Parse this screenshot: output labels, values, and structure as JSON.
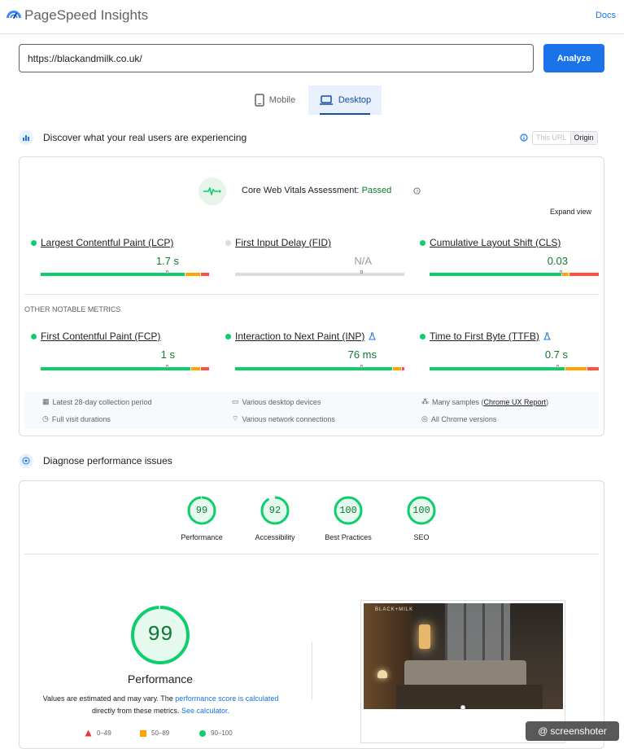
{
  "header": {
    "title": "PageSpeed Insights",
    "docs_label": "Docs"
  },
  "search": {
    "url": "https://blackandmilk.co.uk/",
    "analyze_label": "Analyze"
  },
  "tabs": [
    {
      "label": "Mobile"
    },
    {
      "label": "Desktop",
      "selected": true
    }
  ],
  "real_users": {
    "heading": "Discover what your real users are experiencing",
    "toggle": {
      "this_url": "This URL",
      "origin": "Origin"
    },
    "assessment_label": "Core Web Vitals Assessment:",
    "assessment_status": "Passed",
    "expand_label": "Expand view",
    "metrics": [
      {
        "name": "Largest Contentful Paint (LCP)",
        "value": "1.7 s",
        "status": "good"
      },
      {
        "name": "First Input Delay (FID)",
        "value": "N/A",
        "status": "none"
      },
      {
        "name": "Cumulative Layout Shift (CLS)",
        "value": "0.03",
        "status": "good"
      }
    ],
    "other_label": "OTHER NOTABLE METRICS",
    "other_metrics": [
      {
        "name": "First Contentful Paint (FCP)",
        "value": "1 s"
      },
      {
        "name": "Interaction to Next Paint (INP)",
        "value": "76 ms"
      },
      {
        "name": "Time to First Byte (TTFB)",
        "value": "0.7 s"
      }
    ],
    "info": {
      "period": "Latest 28-day collection period",
      "devices": "Various desktop devices",
      "samples_prefix": "Many samples (",
      "samples_link": "Chrome UX Report",
      "samples_suffix": ")",
      "durations": "Full visit durations",
      "network": "Various network connections",
      "versions": "All Chrome versions"
    }
  },
  "diagnose": {
    "heading": "Diagnose performance issues",
    "scores": [
      {
        "label": "Performance",
        "score": "99",
        "fraction": 0.99
      },
      {
        "label": "Accessibility",
        "score": "92",
        "fraction": 0.92
      },
      {
        "label": "Best Practices",
        "score": "100",
        "fraction": 1.0
      },
      {
        "label": "SEO",
        "score": "100",
        "fraction": 1.0
      }
    ],
    "main_score": "99",
    "main_label": "Performance",
    "note_prefix": "Values are estimated and may vary. The ",
    "note_link1": "performance score is calculated",
    "note_middle": "directly from these metrics. ",
    "note_link2": "See calculator.",
    "legend": [
      {
        "range": "0–49",
        "color": "#e53935"
      },
      {
        "range": "50–89",
        "color": "#ffa400"
      },
      {
        "range": "90–100",
        "color": "#0cce6b"
      }
    ],
    "screenshot_brand": "BLACK+MILK"
  },
  "watermark": "screenshoter",
  "colors": {
    "good": "#0cce6b",
    "average": "#ffa400",
    "poor": "#ff4e42",
    "accent": "#1a73e8",
    "good_text": "#0c7a30"
  }
}
